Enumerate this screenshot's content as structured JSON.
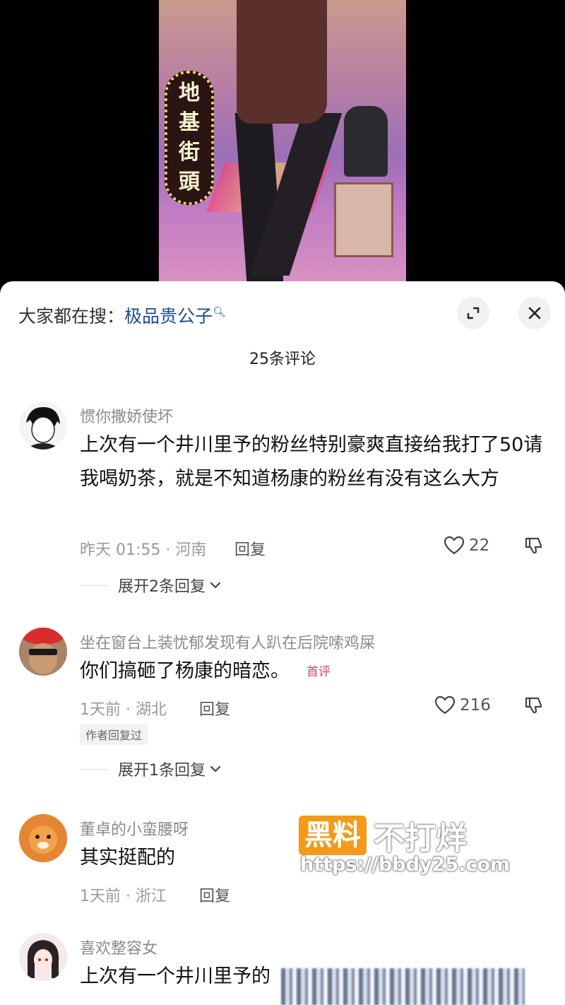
{
  "video": {
    "sign_text": [
      "地",
      "基",
      "街",
      "頭"
    ]
  },
  "header": {
    "search_prefix": "大家都在搜：",
    "search_keyword": "极品贵公子",
    "comment_count": "25条评论"
  },
  "comments": [
    {
      "username": "惯你撒娇使坏",
      "text": "上次有一个井川里予的粉丝特别豪爽直接给我打了50请我喝奶茶，就是不知道杨康的粉丝有没有这么大方",
      "time_location": "昨天 01:55 · 河南",
      "reply_label": "回复",
      "likes": "22",
      "expand_label": "展开2条回复"
    },
    {
      "username": "坐在窗台上装忧郁发现有人趴在后院嗦鸡屎",
      "text": "你们搞砸了杨康的暗恋。",
      "badge": "首评",
      "time_location": "1天前 · 湖北",
      "reply_label": "回复",
      "likes": "216",
      "author_tag": "作者回复过",
      "expand_label": "展开1条回复"
    },
    {
      "username": "董卓的小蛮腰呀",
      "text": "其实挺配的",
      "time_location": "1天前 · 浙江",
      "reply_label": "回复"
    },
    {
      "username": "喜欢整容女",
      "text": "上次有一个井川里予的"
    }
  ],
  "watermark": {
    "box": "黑料",
    "text": "不打烊",
    "url": "https://bbdy25.com"
  }
}
